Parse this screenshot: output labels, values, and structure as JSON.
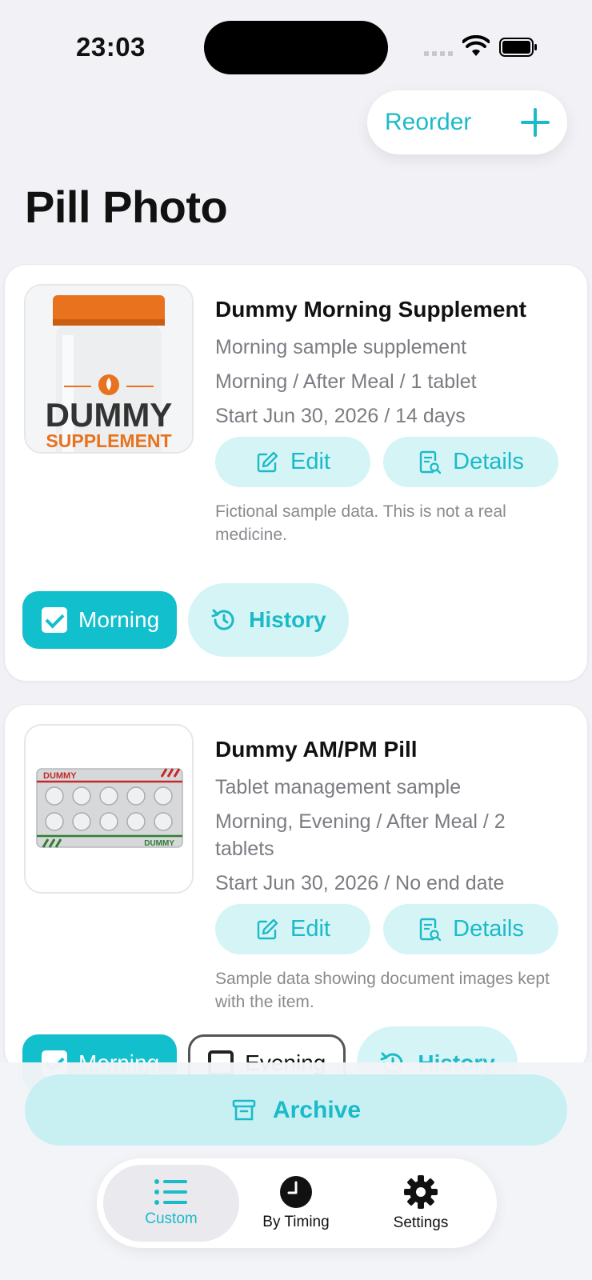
{
  "status": {
    "time": "23:03"
  },
  "toolbar": {
    "reorder_label": "Reorder",
    "add_icon": "plus-icon"
  },
  "page": {
    "title": "Pill Photo"
  },
  "items": [
    {
      "name": "Dummy Morning Supplement",
      "description": "Morning sample supplement",
      "schedule": "Morning / After Meal / 1 tablet",
      "period": "Start Jun 30, 2026 / 14 days",
      "edit_label": "Edit",
      "details_label": "Details",
      "note": "Fictional sample data. This is not a real medicine.",
      "image": {
        "kind": "supplement-bottle",
        "line1": "DUMMY",
        "line2": "SUPPLEMENT"
      },
      "doses": [
        {
          "label": "Morning",
          "checked": true
        }
      ],
      "history_label": "History"
    },
    {
      "name": "Dummy AM/PM Pill",
      "description": "Tablet management sample",
      "schedule": "Morning, Evening / After Meal / 2 tablets",
      "period": "Start Jun 30, 2026 / No end date",
      "edit_label": "Edit",
      "details_label": "Details",
      "note": "Sample data showing document images kept with the item.",
      "image": {
        "kind": "blister-pack",
        "label_top": "DUMMY",
        "label_bottom": "DUMMY"
      },
      "doses": [
        {
          "label": "Morning",
          "checked": true
        },
        {
          "label": "Evening",
          "checked": false
        }
      ],
      "history_label": "History"
    }
  ],
  "archive": {
    "label": "Archive"
  },
  "tabs": [
    {
      "label": "Custom",
      "icon": "list-icon",
      "selected": true
    },
    {
      "label": "By Timing",
      "icon": "clock-icon",
      "selected": false
    },
    {
      "label": "Settings",
      "icon": "gear-icon",
      "selected": false
    }
  ],
  "colors": {
    "accent": "#1bbac8",
    "chip_on": "#12bfcc",
    "soft": "#d5f4f6"
  }
}
